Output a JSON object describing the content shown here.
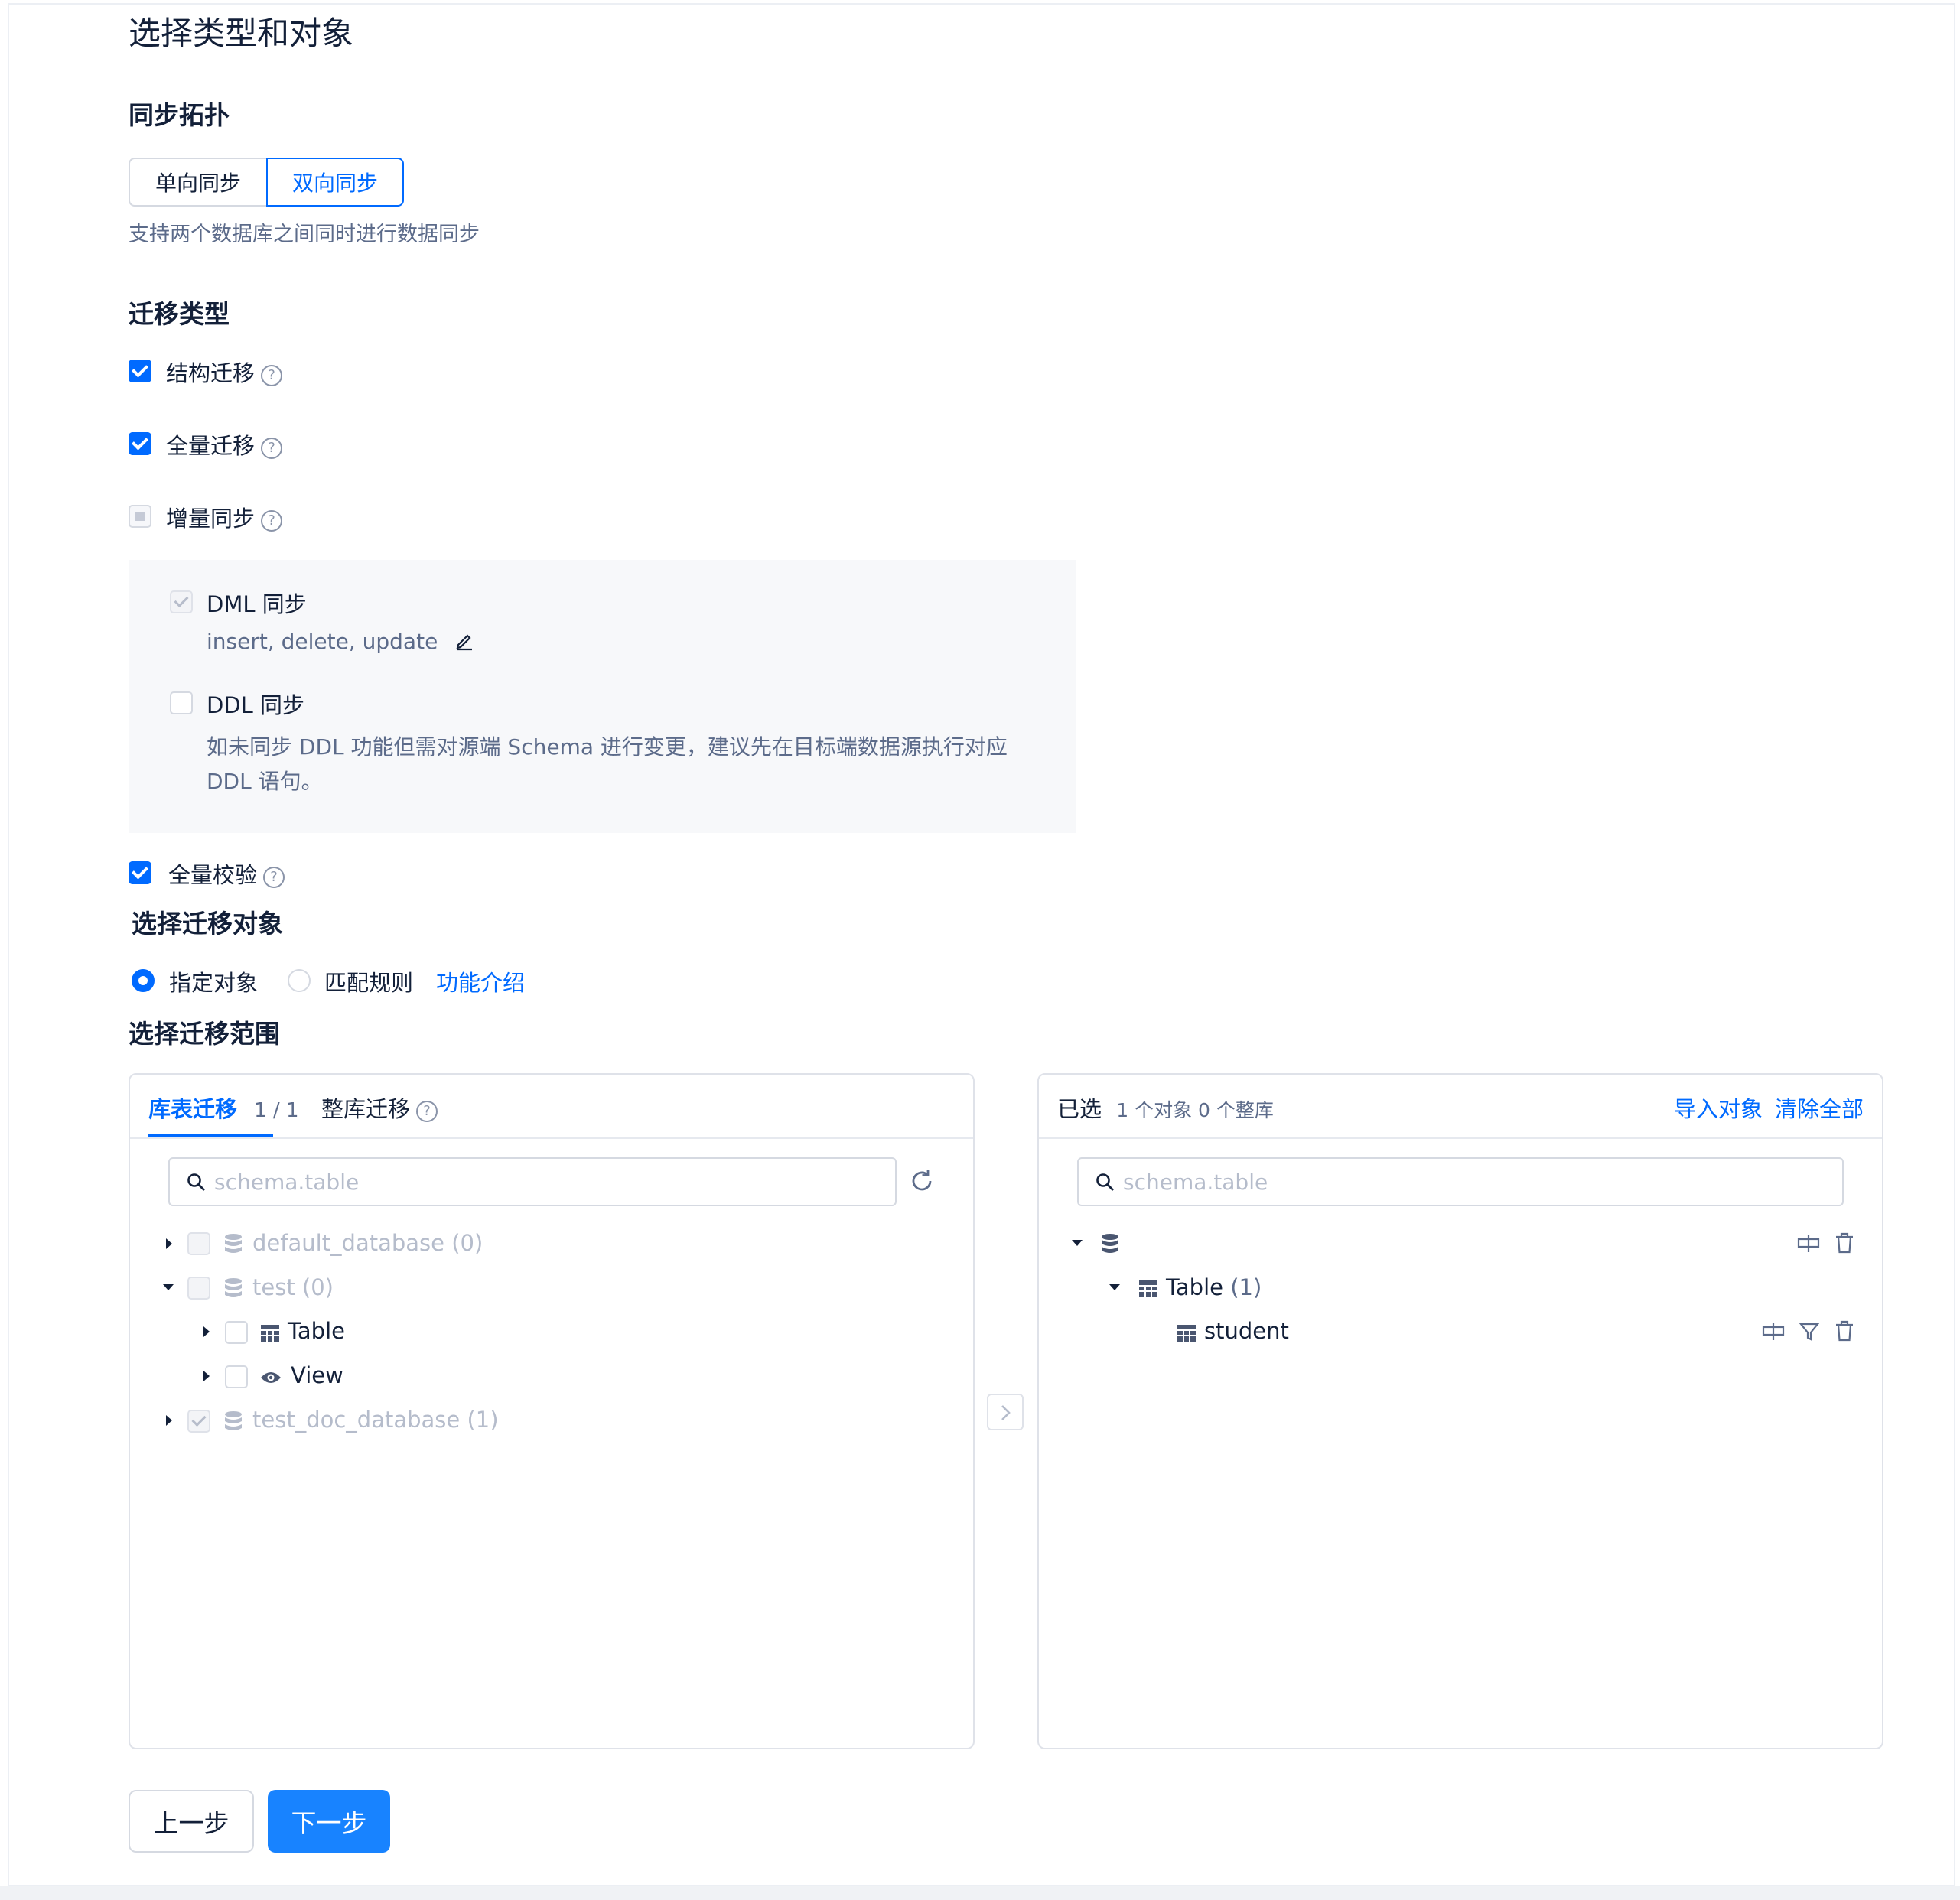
{
  "page_title": "选择类型和对象",
  "topology": {
    "heading": "同步拓扑",
    "options": [
      "单向同步",
      "双向同步"
    ],
    "selected": "双向同步",
    "hint": "支持两个数据库之间同时进行数据同步"
  },
  "migration_type": {
    "heading": "迁移类型",
    "structure": "结构迁移",
    "full": "全量迁移",
    "incremental": "增量同步",
    "dml_label": "DML 同步",
    "dml_ops": "insert, delete, update",
    "ddl_label": "DDL 同步",
    "ddl_hint_line1": "如未同步 DDL 功能但需对源端 Schema 进行变更，建议先在目标端数据源执行对应",
    "ddl_hint_line2": "DDL 语句。",
    "full_check": "全量校验"
  },
  "object_select": {
    "heading": "选择迁移对象",
    "specified": "指定对象",
    "match_rule": "匹配规则",
    "intro_link": "功能介绍"
  },
  "range": {
    "heading": "选择迁移范围",
    "left": {
      "tab_active": "库表迁移",
      "tab_active_count": "1 / 1",
      "tab_other": "整库迁移",
      "search_placeholder": "schema.table",
      "tree": [
        {
          "label": "default_database (0)"
        },
        {
          "label": "test (0)"
        },
        {
          "label": "Table"
        },
        {
          "label": "View"
        },
        {
          "label": "test_doc_database (1)"
        }
      ]
    },
    "right": {
      "title": "已选",
      "summary": "1 个对象 0 个整库",
      "import": "导入对象",
      "clear": "清除全部",
      "search_placeholder": "schema.table",
      "table_node": "Table",
      "table_count": "(1)",
      "item": "student"
    }
  },
  "footer": {
    "prev": "上一步",
    "next": "下一步"
  },
  "colors": {
    "primary": "#006aff",
    "button_primary": "#1883ff",
    "text": "#132039",
    "muted": "#5c6b8a",
    "disabled": "#b5bccb"
  }
}
